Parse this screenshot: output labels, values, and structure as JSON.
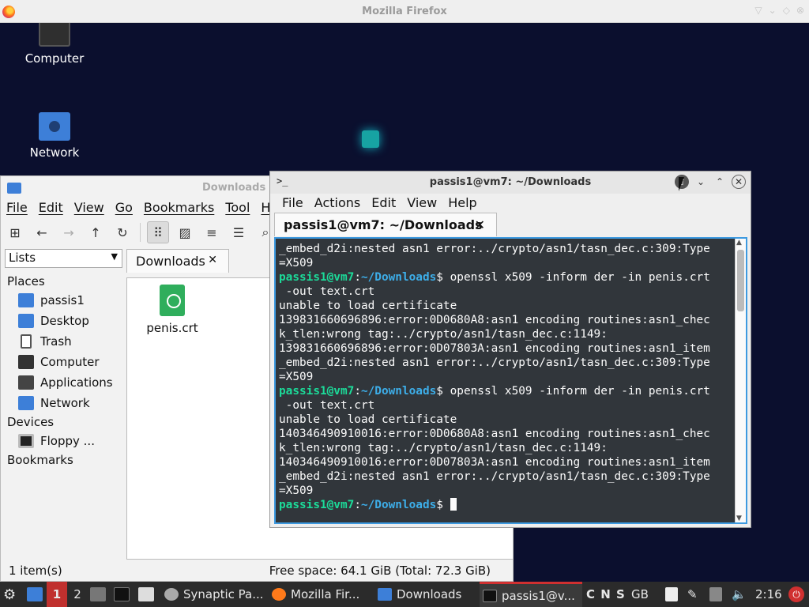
{
  "firefox": {
    "title": "Mozilla Firefox"
  },
  "desktop": {
    "icons": [
      {
        "label": "Computer"
      },
      {
        "label": "Network"
      }
    ]
  },
  "file_manager": {
    "title": "Downloads",
    "menu": [
      "File",
      "Edit",
      "View",
      "Go",
      "Bookmarks",
      "Tool",
      "He"
    ],
    "sidepane_mode": "Lists",
    "sections": {
      "places": "Places",
      "devices": "Devices",
      "bookmarks": "Bookmarks"
    },
    "places": [
      "passis1",
      "Desktop",
      "Trash",
      "Computer",
      "Applications",
      "Network"
    ],
    "devices": [
      "Floppy ..."
    ],
    "tab_label": "Downloads",
    "files": [
      {
        "name": "penis.crt"
      }
    ],
    "status_left": "1 item(s)",
    "status_right": "Free space: 64.1 GiB (Total: 72.3 GiB)"
  },
  "terminal": {
    "title": "passis1@vm7: ~/Downloads",
    "menu": [
      "File",
      "Actions",
      "Edit",
      "View",
      "Help"
    ],
    "tab_label": "passis1@vm7: ~/Downloads",
    "prompt_user": "passis1@vm7",
    "prompt_path": "~/Downloads",
    "lines": [
      "_embed_d2i:nested asn1 error:../crypto/asn1/tasn_dec.c:309:Type",
      "=X509",
      "$ openssl x509 -inform der -in penis.crt",
      " -out text.crt",
      "unable to load certificate",
      "139831660696896:error:0D0680A8:asn1 encoding routines:asn1_chec",
      "k_tlen:wrong tag:../crypto/asn1/tasn_dec.c:1149:",
      "139831660696896:error:0D07803A:asn1 encoding routines:asn1_item",
      "_embed_d2i:nested asn1 error:../crypto/asn1/tasn_dec.c:309:Type",
      "=X509",
      "$ openssl x509 -inform der -in penis.crt",
      " -out text.crt",
      "unable to load certificate",
      "140346490910016:error:0D0680A8:asn1 encoding routines:asn1_chec",
      "k_tlen:wrong tag:../crypto/asn1/tasn_dec.c:1149:",
      "140346490910016:error:0D07803A:asn1 encoding routines:asn1_item",
      "_embed_d2i:nested asn1 error:../crypto/asn1/tasn_dec.c:309:Type",
      "=X509",
      "$ "
    ]
  },
  "taskbar": {
    "workspaces": [
      "1",
      "2"
    ],
    "tasks": [
      "Synaptic Pa...",
      "Mozilla Fir...",
      "Downloads",
      "passis1@v..."
    ],
    "tray_indicators": "C N S",
    "keyboard_layout": "GB",
    "clock": "2:16"
  },
  "colors": {
    "desktop_bg": "#0b0f2e",
    "terminal_bg": "#31363b",
    "prompt_user": "#1cdc9a",
    "prompt_path": "#3daee9",
    "focus_blue": "#3d9ae0"
  }
}
